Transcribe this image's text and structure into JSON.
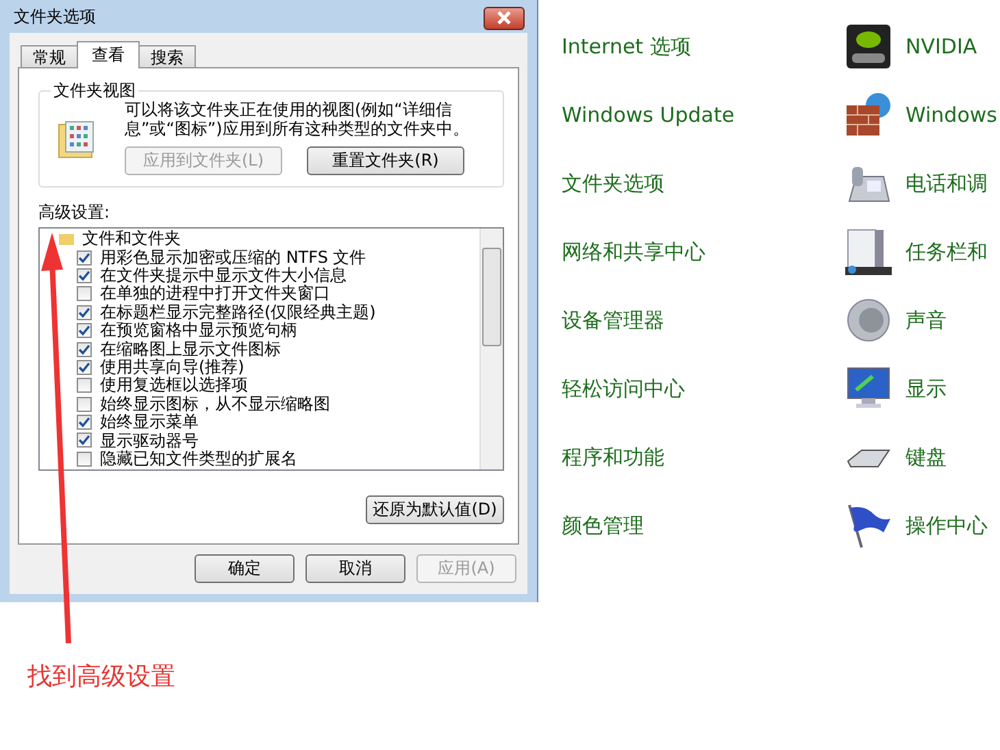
{
  "dialog": {
    "title": "文件夹选项",
    "tabs": [
      {
        "label": "常规",
        "selected": false
      },
      {
        "label": "查看",
        "selected": true
      },
      {
        "label": "搜索",
        "selected": false
      }
    ],
    "folder_views": {
      "legend": "文件夹视图",
      "description": "可以将该文件夹正在使用的视图(例如“详细信息”或“图标”)应用到所有这种类型的文件夹中。",
      "buttons": [
        {
          "label": "应用到文件夹(L)",
          "disabled": true
        },
        {
          "label": "重置文件夹(R)",
          "disabled": false
        }
      ]
    },
    "advanced": {
      "label": "高级设置:",
      "group": "文件和文件夹",
      "options": [
        {
          "label": "用彩色显示加密或压缩的 NTFS 文件",
          "checked": true
        },
        {
          "label": "在文件夹提示中显示文件大小信息",
          "checked": true
        },
        {
          "label": "在单独的进程中打开文件夹窗口",
          "checked": false
        },
        {
          "label": "在标题栏显示完整路径(仅限经典主题)",
          "checked": true
        },
        {
          "label": "在预览窗格中显示预览句柄",
          "checked": true
        },
        {
          "label": "在缩略图上显示文件图标",
          "checked": true
        },
        {
          "label": "使用共享向导(推荐)",
          "checked": true
        },
        {
          "label": "使用复选框以选择项",
          "checked": false
        },
        {
          "label": "始终显示图标，从不显示缩略图",
          "checked": false
        },
        {
          "label": "始终显示菜单",
          "checked": true
        },
        {
          "label": "显示驱动器号",
          "checked": true
        },
        {
          "label": "隐藏已知文件类型的扩展名",
          "checked": false
        }
      ],
      "restore_button": "还原为默认值(D)"
    },
    "buttons": [
      {
        "label": "确定",
        "disabled": false
      },
      {
        "label": "取消",
        "disabled": false
      },
      {
        "label": "应用(A)",
        "disabled": true
      }
    ]
  },
  "control_panel": {
    "items": [
      {
        "label": "Internet 选项",
        "kind": "none"
      },
      {
        "label": "NVIDIA",
        "kind": "nvidia"
      },
      {
        "label": "Windows Update",
        "kind": "none"
      },
      {
        "label": "Windows",
        "kind": "firewall"
      },
      {
        "label": "文件夹选项",
        "kind": "none"
      },
      {
        "label": "电话和调",
        "kind": "phone"
      },
      {
        "label": "网络和共享中心",
        "kind": "none"
      },
      {
        "label": "任务栏和",
        "kind": "taskbar"
      },
      {
        "label": "设备管理器",
        "kind": "none"
      },
      {
        "label": "声音",
        "kind": "sound"
      },
      {
        "label": "轻松访问中心",
        "kind": "none"
      },
      {
        "label": "显示",
        "kind": "display"
      },
      {
        "label": "程序和功能",
        "kind": "none"
      },
      {
        "label": "键盘",
        "kind": "keyboard"
      },
      {
        "label": "颜色管理",
        "kind": "none"
      },
      {
        "label": "操作中心",
        "kind": "flag"
      }
    ]
  },
  "annotation": "找到高级设置"
}
